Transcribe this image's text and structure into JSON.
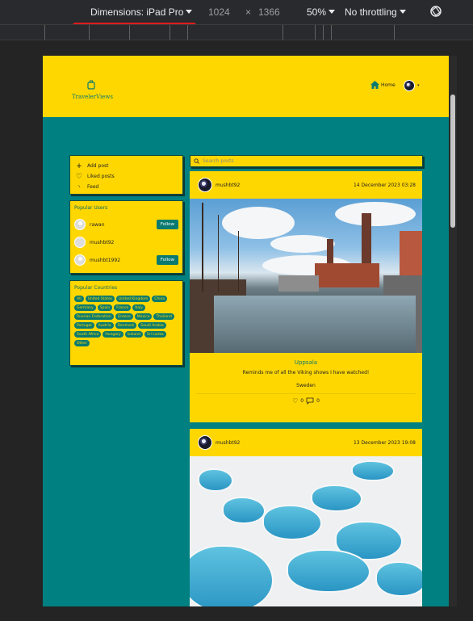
{
  "devtools": {
    "dimensions_label": "Dimensions: iPad Pro",
    "width": "1024",
    "times": "×",
    "height": "1366",
    "zoom": "50%",
    "throttling": "No throttling"
  },
  "header": {
    "brand": "TravelerViews",
    "home_label": "Home"
  },
  "sidebar": {
    "menu": [
      {
        "icon": "plus-icon",
        "label": "Add post"
      },
      {
        "icon": "heart-icon",
        "label": "Liked posts"
      },
      {
        "icon": "rss-icon",
        "label": "Feed"
      }
    ],
    "popular_users_title": "Popular Users",
    "users": [
      {
        "name": "rawan",
        "follow": "Follow"
      },
      {
        "name": "mushbt92",
        "follow": ""
      },
      {
        "name": "mushbt1992",
        "follow": "Follow"
      }
    ],
    "popular_countries_title": "Popular Countries",
    "countries": [
      "All",
      "United States",
      "United Kingdom",
      "China",
      "Germany",
      "Spain",
      "France",
      "Italy",
      "Russian Federation",
      "Greece",
      "Mexico",
      "Thailand",
      "Portugal",
      "Austria",
      "Denmark",
      "Saudi Arabia",
      "South Africa",
      "Hungary",
      "Iceland",
      "Sri Lanka",
      "Other"
    ]
  },
  "feed": {
    "search_placeholder": "Search posts",
    "posts": [
      {
        "user": "mushbt92",
        "date": "14 December 2023 03:28",
        "title": "Uppsala",
        "description": "Reminds me of all the Viking shows I have watched!",
        "country": "Sweden",
        "likes": "0",
        "comments": "0"
      },
      {
        "user": "mushbt92",
        "date": "13 December 2023 19:08"
      }
    ]
  },
  "colors": {
    "teal": "#008080",
    "yellow": "#ffd700",
    "accent": "#0a7a70"
  }
}
